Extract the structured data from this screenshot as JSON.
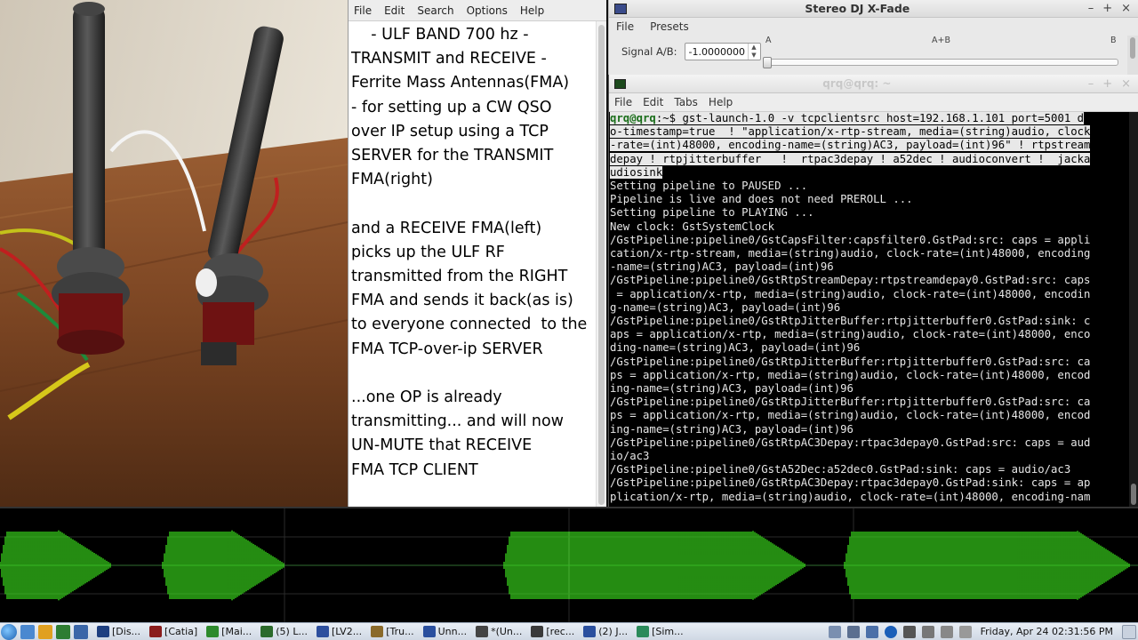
{
  "editor": {
    "menu": [
      "File",
      "Edit",
      "Search",
      "Options",
      "Help"
    ],
    "text": "    - ULF BAND 700 hz -\nTRANSMIT and RECEIVE -\nFerrite Mass Antennas(FMA)\n- for setting up a CW QSO\nover IP setup using a TCP\nSERVER for the TRANSMIT\nFMA(right)\n\nand a RECEIVE FMA(left)\npicks up the ULF RF\ntransmitted from the RIGHT\nFMA and sends it back(as is)\nto everyone connected  to the\nFMA TCP-over-ip SERVER\n\n...one OP is already\ntransmitting... and will now\nUN-MUTE that RECEIVE\nFMA TCP CLIENT"
  },
  "dj": {
    "title": "Stereo DJ X-Fade",
    "menu": [
      "File",
      "Presets"
    ],
    "signal_label": "Signal A/B:",
    "signal_value": "-1.0000000",
    "slider_labels": {
      "a": "A",
      "mid": "A+B",
      "b": "B"
    },
    "crossfade_level": 0.0
  },
  "terminal": {
    "title": "qrq@qrq: ~",
    "menu": [
      "File",
      "Edit",
      "Tabs",
      "Help"
    ],
    "prompt": "qrq@qrq",
    "prompt_path": ":~$",
    "command_lines": [
      " gst-launch-1.0 -v tcpclientsrc host=192.168.1.101 port=5001 d",
      "o-timestamp=true  ! \"application/x-rtp-stream, media=(string)audio, clock",
      "-rate=(int)48000, encoding-name=(string)AC3, payload=(int)96\" ! rtpstream",
      "depay ! rtpjitterbuffer   !  rtpac3depay ! a52dec ! audioconvert !  jacka",
      "udiosink"
    ],
    "output_lines": [
      "Setting pipeline to PAUSED ...",
      "Pipeline is live and does not need PREROLL ...",
      "Setting pipeline to PLAYING ...",
      "New clock: GstSystemClock",
      "/GstPipeline:pipeline0/GstCapsFilter:capsfilter0.GstPad:src: caps = appli",
      "cation/x-rtp-stream, media=(string)audio, clock-rate=(int)48000, encoding",
      "-name=(string)AC3, payload=(int)96",
      "/GstPipeline:pipeline0/GstRtpStreamDepay:rtpstreamdepay0.GstPad:src: caps",
      " = application/x-rtp, media=(string)audio, clock-rate=(int)48000, encodin",
      "g-name=(string)AC3, payload=(int)96",
      "/GstPipeline:pipeline0/GstRtpJitterBuffer:rtpjitterbuffer0.GstPad:sink: c",
      "aps = application/x-rtp, media=(string)audio, clock-rate=(int)48000, enco",
      "ding-name=(string)AC3, payload=(int)96",
      "/GstPipeline:pipeline0/GstRtpJitterBuffer:rtpjitterbuffer0.GstPad:src: ca",
      "ps = application/x-rtp, media=(string)audio, clock-rate=(int)48000, encod",
      "ing-name=(string)AC3, payload=(int)96",
      "/GstPipeline:pipeline0/GstRtpJitterBuffer:rtpjitterbuffer0.GstPad:src: ca",
      "ps = application/x-rtp, media=(string)audio, clock-rate=(int)48000, encod",
      "ing-name=(string)AC3, payload=(int)96",
      "/GstPipeline:pipeline0/GstRtpAC3Depay:rtpac3depay0.GstPad:src: caps = aud",
      "io/ac3",
      "/GstPipeline:pipeline0/GstA52Dec:a52dec0.GstPad:sink: caps = audio/ac3",
      "/GstPipeline:pipeline0/GstRtpAC3Depay:rtpac3depay0.GstPad:sink: caps = ap",
      "plication/x-rtp, media=(string)audio, clock-rate=(int)48000, encoding-nam"
    ]
  },
  "taskbar": {
    "tasks": [
      {
        "label": "[Dis...",
        "color": "#1e3f80"
      },
      {
        "label": "[Catia]",
        "color": "#8a1c1c"
      },
      {
        "label": "[Mai...",
        "color": "#2d8a2d"
      },
      {
        "label": "(5) L...",
        "color": "#2b6a2b"
      },
      {
        "label": "[LV2...",
        "color": "#2d4f9e"
      },
      {
        "label": "[Tru...",
        "color": "#8a6a2a"
      },
      {
        "label": "Unn...",
        "color": "#2a4f9e"
      },
      {
        "label": "*(Un...",
        "color": "#444444"
      },
      {
        "label": "[rec...",
        "color": "#3a3a3a"
      },
      {
        "label": "(2) J...",
        "color": "#2a4f9e"
      },
      {
        "label": "[Sim...",
        "color": "#2a8a5a"
      }
    ],
    "clock": "Friday, Apr 24 02:31:56 PM"
  },
  "colors": {
    "scope_trace": "#3ee81e",
    "terminal_prompt": "#3ae03a"
  }
}
